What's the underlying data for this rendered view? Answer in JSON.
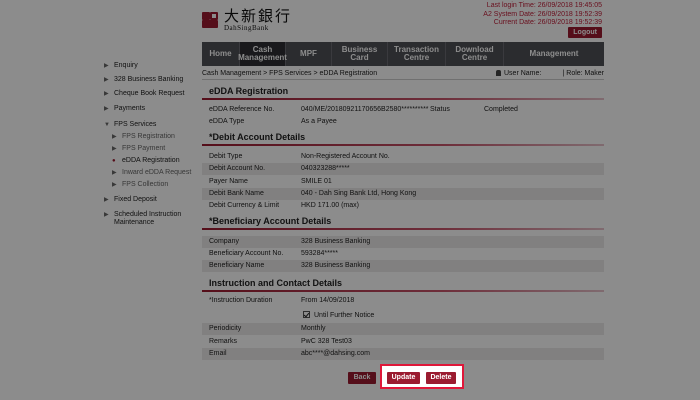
{
  "header": {
    "logo_cn": "大新銀行",
    "logo_en": "DahSingBank",
    "last_login": "Last login Time: 26/09/2018 19:45:05",
    "system_date": "A2 System Date: 26/09/2018 19:52:39",
    "current_date": "Current Date: 26/09/2018 19:52:39",
    "logout": "Logout"
  },
  "nav": {
    "home": "Home",
    "cash": "Cash Management",
    "mpf": "MPF",
    "business_card": "Business Card",
    "transaction": "Transaction Centre",
    "download": "Download Centre",
    "management": "Management"
  },
  "crumb": {
    "path": "Cash Management > FPS Services > eDDA Registration",
    "user": "User Name:",
    "role": "| Role: Maker"
  },
  "sidebar": {
    "enquiry": "Enquiry",
    "banking": "328 Business Banking",
    "cheque": "Cheque Book Request",
    "payments": "Payments",
    "fps": "FPS Services",
    "fps_reg": "FPS Registration",
    "fps_pay": "FPS Payment",
    "edda": "eDDA Registration",
    "inward": "Inward eDDA Request",
    "collection": "FPS Collection",
    "fixed": "Fixed Deposit",
    "scheduled": "Scheduled Instruction Maintenance"
  },
  "edda": {
    "title": "eDDA Registration",
    "ref_label": "eDDA Reference No.",
    "ref_value": "040/ME/20180921170656B2580**********",
    "status_label": "Status",
    "status_value": "Completed",
    "type_label": "eDDA Type",
    "type_value": "As a Payee"
  },
  "debit": {
    "title": "*Debit Account Details",
    "type_label": "Debit Type",
    "type_value": "Non-Registered Account No.",
    "acct_label": "Debit Account No.",
    "acct_value": "040323288*****",
    "payer_label": "Payer Name",
    "payer_value": "SMILE 01",
    "bank_label": "Debit Bank Name",
    "bank_value": "040 - Dah Sing Bank Ltd, Hong Kong",
    "limit_label": "Debit Currency & Limit",
    "limit_value": "HKD 171.00 (max)"
  },
  "beneficiary": {
    "title": "*Beneficiary Account Details",
    "company_label": "Company",
    "company_value": "328 Business Banking",
    "acct_label": "Beneficiary Account No.",
    "acct_value": "593284*****",
    "name_label": "Beneficiary Name",
    "name_value": "328 Business Banking"
  },
  "instruction": {
    "title": "Instruction and Contact Details",
    "duration_label": "*Instruction Duration",
    "duration_value": "From    14/09/2018",
    "until_label": "Until Further Notice",
    "periodicity_label": "Periodicity",
    "periodicity_value": "Monthly",
    "remarks_label": "Remarks",
    "remarks_value": "PwC 328 Test03",
    "email_label": "Email",
    "email_value": "abc****@dahsing.com"
  },
  "buttons": {
    "back": "Back",
    "update": "Update",
    "delete": "Delete"
  }
}
